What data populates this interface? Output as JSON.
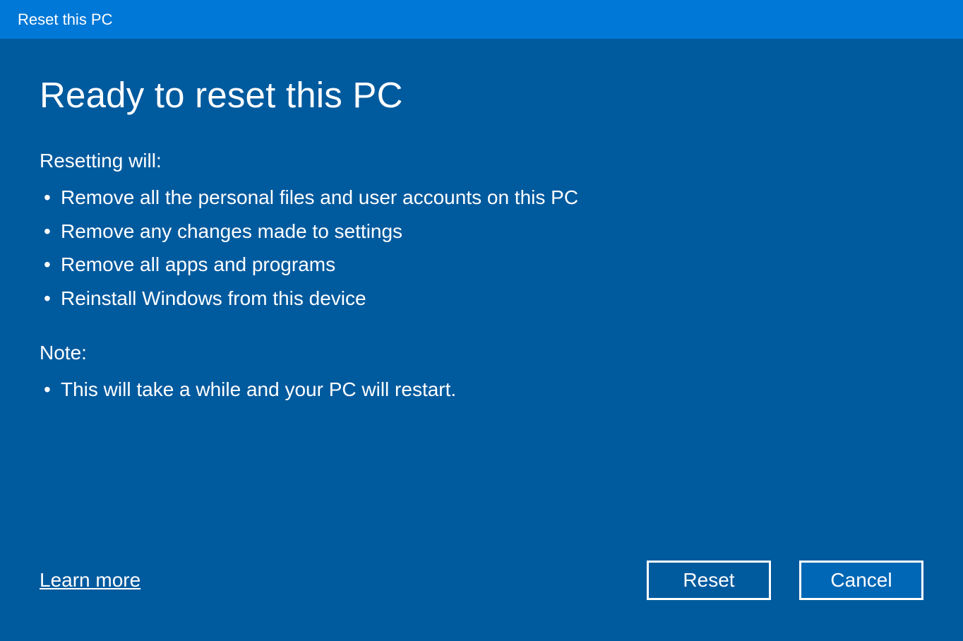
{
  "titlebar": {
    "title": "Reset this PC"
  },
  "main": {
    "heading": "Ready to reset this PC",
    "resetting_label": "Resetting will:",
    "bullets": [
      "Remove all the personal files and user accounts on this PC",
      "Remove any changes made to settings",
      "Remove all apps and programs",
      "Reinstall Windows from this device"
    ],
    "note_label": "Note:",
    "note_bullets": [
      "This will take a while and your PC will restart."
    ]
  },
  "footer": {
    "learn_more": "Learn more",
    "reset_label": "Reset",
    "cancel_label": "Cancel"
  }
}
